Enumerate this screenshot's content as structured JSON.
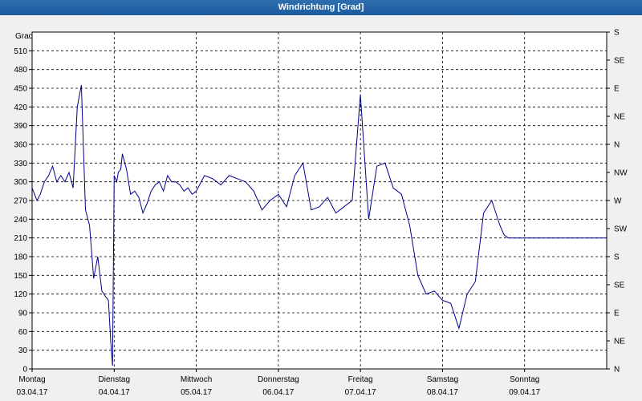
{
  "window": {
    "title": "Windrichtung [Grad]"
  },
  "chart_data": {
    "type": "line",
    "title": "Windrichtung [Grad]",
    "ylabel": "Grad",
    "ylim": [
      0,
      540
    ],
    "y_ticks": [
      0,
      30,
      60,
      90,
      120,
      150,
      180,
      210,
      240,
      270,
      300,
      330,
      360,
      390,
      420,
      450,
      480,
      510
    ],
    "right_axis_labels": [
      "N",
      "NE",
      "E",
      "SE",
      "S",
      "SW",
      "W",
      "NW",
      "N",
      "NE",
      "E",
      "SE",
      "S"
    ],
    "x_range_days": [
      0,
      7
    ],
    "x_categories": [
      {
        "day": "Montag",
        "date": "03.04.17"
      },
      {
        "day": "Dienstag",
        "date": "04.04.17"
      },
      {
        "day": "Mittwoch",
        "date": "05.04.17"
      },
      {
        "day": "Donnerstag",
        "date": "06.04.17"
      },
      {
        "day": "Freitag",
        "date": "07.04.17"
      },
      {
        "day": "Samstag",
        "date": "08.04.17"
      },
      {
        "day": "Sonntag",
        "date": "09.04.17"
      }
    ],
    "grid": true,
    "series": [
      {
        "color": "#00008b",
        "x": [
          0,
          0.06,
          0.1,
          0.15,
          0.2,
          0.25,
          0.3,
          0.35,
          0.4,
          0.45,
          0.5,
          0.55,
          0.6,
          0.65,
          0.7,
          0.75,
          0.8,
          0.85,
          0.9,
          0.93,
          0.96,
          0.98,
          1.0,
          1.03,
          1.05,
          1.08,
          1.1,
          1.15,
          1.2,
          1.25,
          1.3,
          1.35,
          1.4,
          1.45,
          1.5,
          1.55,
          1.6,
          1.65,
          1.7,
          1.75,
          1.8,
          1.85,
          1.9,
          1.95,
          2.0,
          2.1,
          2.2,
          2.25,
          2.3,
          2.4,
          2.5,
          2.6,
          2.7,
          2.8,
          2.9,
          3.0,
          3.1,
          3.2,
          3.3,
          3.4,
          3.5,
          3.6,
          3.7,
          3.8,
          3.9,
          4.0,
          4.1,
          4.2,
          4.3,
          4.4,
          4.5,
          4.6,
          4.7,
          4.8,
          4.9,
          5.0,
          5.1,
          5.2,
          5.3,
          5.4,
          5.5,
          5.6,
          5.7,
          5.75,
          5.8,
          5.85,
          5.9,
          5.95,
          6.0,
          6.1,
          6.2,
          6.3,
          6.4,
          6.5,
          6.6,
          6.65,
          6.7,
          6.75,
          6.8,
          6.85,
          6.9,
          6.95,
          7.0
        ],
        "y": [
          290,
          270,
          280,
          300,
          310,
          325,
          300,
          310,
          300,
          315,
          290,
          420,
          455,
          255,
          230,
          145,
          180,
          125,
          115,
          110,
          40,
          5,
          310,
          300,
          315,
          320,
          345,
          320,
          280,
          285,
          275,
          250,
          265,
          285,
          295,
          300,
          285,
          310,
          300,
          300,
          295,
          285,
          290,
          280,
          285,
          310,
          305,
          300,
          295,
          310,
          305,
          300,
          285,
          255,
          270,
          280,
          260,
          310,
          330,
          255,
          260,
          275,
          250,
          260,
          270,
          440,
          240,
          325,
          330,
          290,
          280,
          230,
          150,
          120,
          125,
          110,
          105,
          65,
          120,
          140,
          250,
          270,
          230,
          215,
          210,
          210,
          210,
          210,
          210,
          210,
          210,
          210,
          210,
          210,
          210,
          210,
          210,
          210,
          210,
          210,
          210,
          210,
          210
        ]
      }
    ]
  }
}
